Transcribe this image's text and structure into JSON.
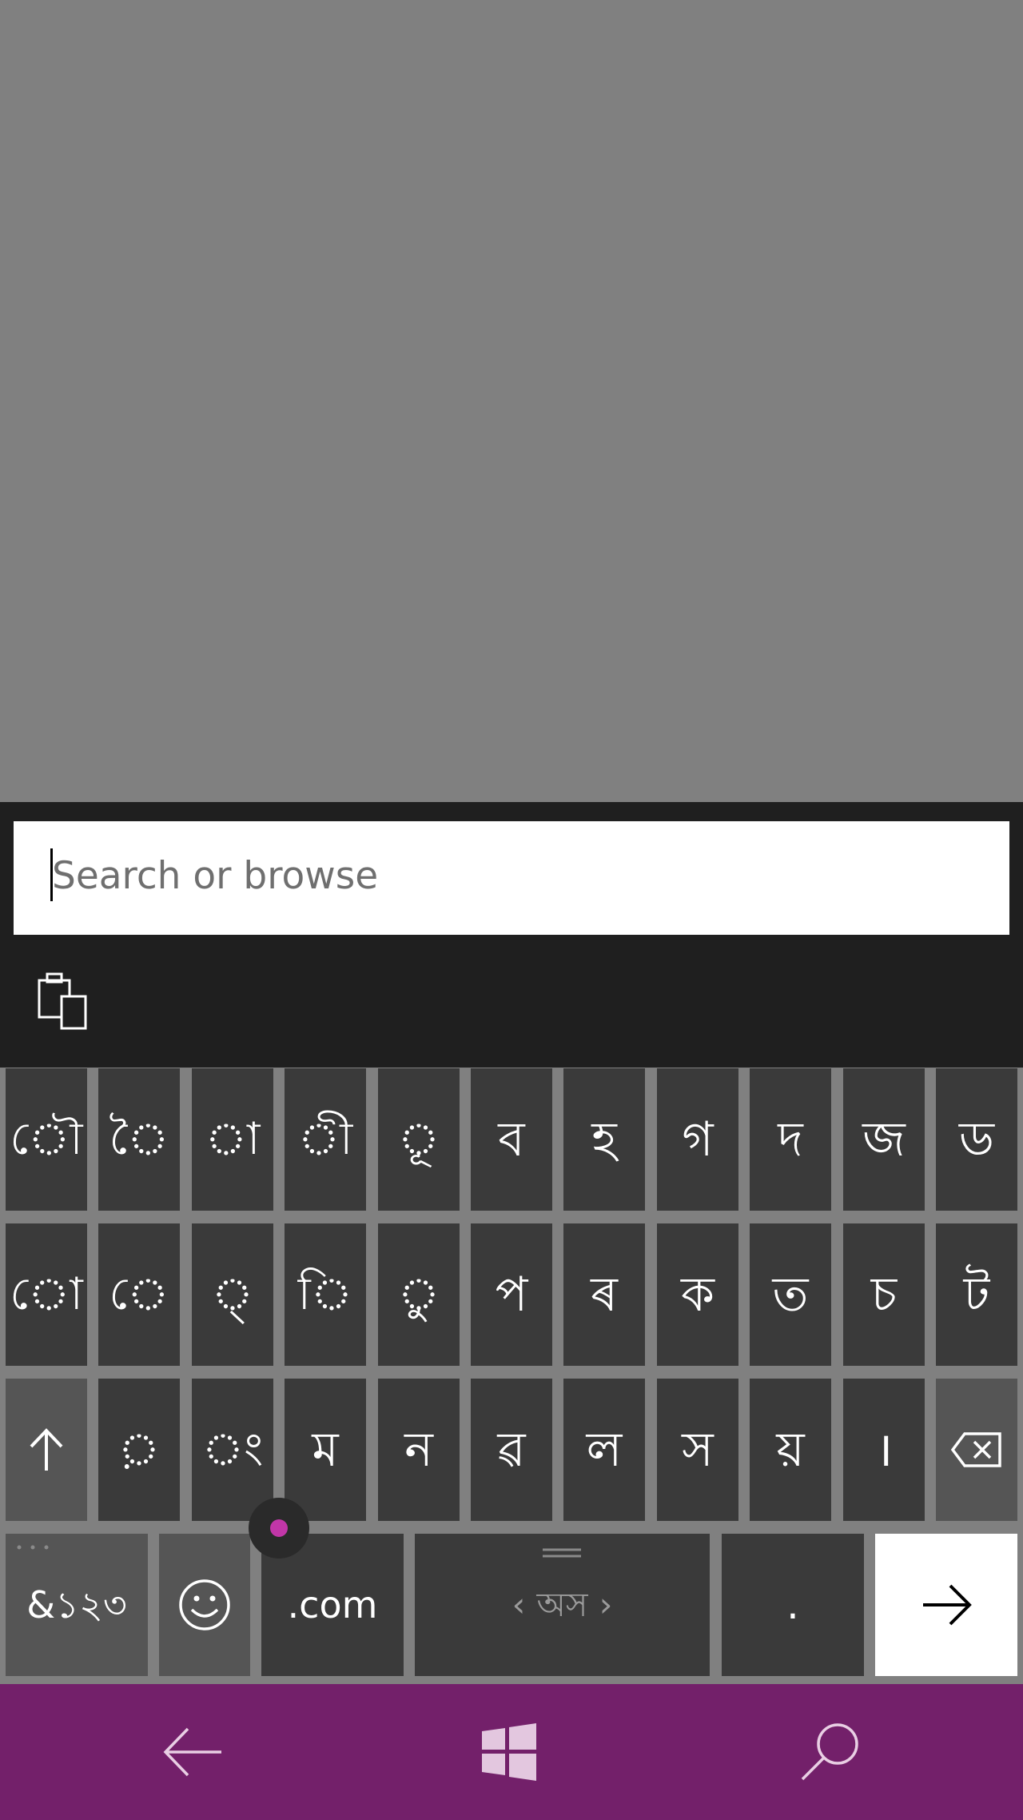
{
  "address_bar": {
    "placeholder": "Search or browse",
    "value": ""
  },
  "suggestion_bar": {
    "clipboard_icon": "clipboard-paste-icon"
  },
  "keyboard": {
    "layout": "Assamese",
    "row1": [
      "ৌ",
      "ৈ",
      "া",
      "ী",
      "ূ",
      "ব",
      "হ",
      "গ",
      "দ",
      "জ",
      "ড"
    ],
    "row2": [
      "ো",
      "ে",
      "্",
      "ি",
      "ু",
      "প",
      "ৰ",
      "ক",
      "ত",
      "চ",
      "ট"
    ],
    "row3": [
      "shift",
      "়",
      "ং",
      "ম",
      "ন",
      "ৱ",
      "ল",
      "স",
      "য়",
      "।",
      "backspace"
    ],
    "row4": {
      "symbols_label": "&১২৩",
      "emoji_icon": "smiley-icon",
      "dotcom_label": ".com",
      "space_label": "অস",
      "period_label": ".",
      "enter_icon": "arrow-right-icon"
    },
    "key_color": "#3a3a3a",
    "function_key_color": "#555555",
    "accent_color": "#c236a8"
  },
  "nav_bar": {
    "color": "#73206a",
    "back_icon": "back-arrow-icon",
    "start_icon": "windows-logo-icon",
    "search_icon": "search-icon"
  }
}
